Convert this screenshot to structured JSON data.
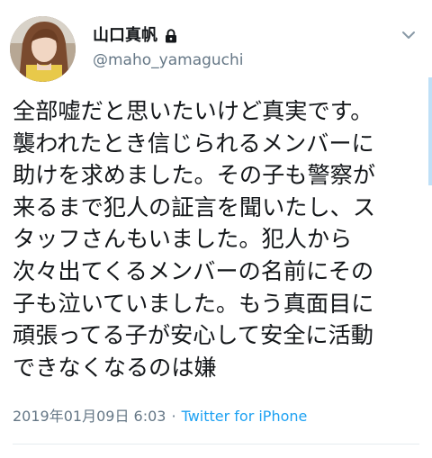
{
  "author": {
    "display_name": "山口真帆",
    "username": "@maho_yamaguchi",
    "protected_icon": "lock-icon",
    "avatar_icon": "avatar-photo"
  },
  "tweet": {
    "lines": [
      "全部嘘だと思いたいけど真実です。",
      "襲われたとき信じられるメンバーに",
      "助けを求めました。その子も警察が",
      "来るまで犯人の証言を聞いたし、ス",
      "タッフさんもいました。犯人から",
      "次々出てくるメンバーの名前にその",
      "子も泣いていました。もう真面目に",
      "頑張ってる子が安心して安全に活動",
      "できなくなるのは嫌"
    ],
    "timestamp": "2019年01月09日 6:03",
    "separator": "·",
    "source": "Twitter for iPhone"
  },
  "menu": {
    "icon": "chevron-down-icon"
  },
  "colors": {
    "text": "#14171a",
    "secondary": "#657786",
    "link": "#1da1f2",
    "divider": "#e6ecf0"
  }
}
